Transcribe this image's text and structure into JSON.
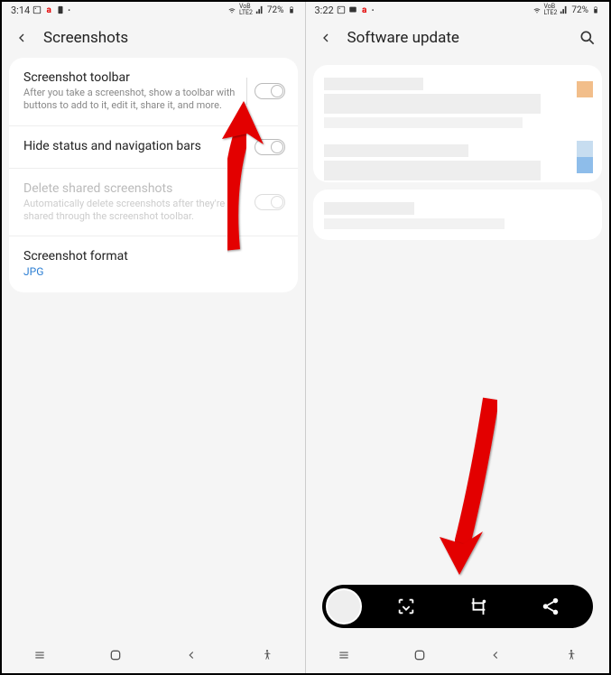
{
  "left": {
    "status": {
      "time": "3:14",
      "battery": "72%"
    },
    "header": {
      "title": "Screenshots"
    },
    "items": {
      "toolbar": {
        "title": "Screenshot toolbar",
        "sub": "After you take a screenshot, show a toolbar with buttons to add to it, edit it, share it, and more."
      },
      "hide": {
        "title": "Hide status and navigation bars"
      },
      "delete": {
        "title": "Delete shared screenshots",
        "sub": "Automatically delete screenshots after they're shared through the screenshot toolbar."
      },
      "format": {
        "title": "Screenshot format",
        "value": "JPG"
      }
    }
  },
  "right": {
    "status": {
      "time": "3:22",
      "battery": "72%"
    },
    "header": {
      "title": "Software update"
    }
  }
}
